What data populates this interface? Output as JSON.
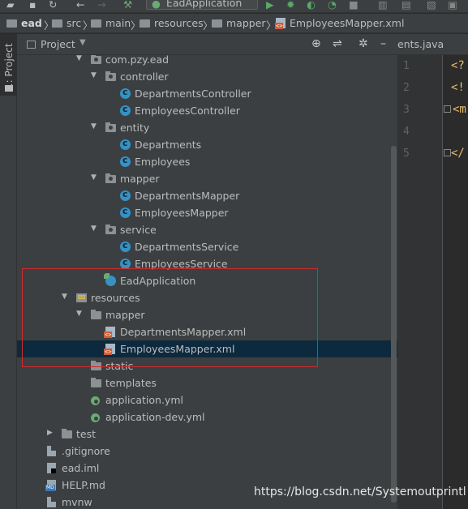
{
  "toolbar": {
    "run_config": "EadApplication"
  },
  "breadcrumb": [
    {
      "label": "ead",
      "bold": true
    },
    {
      "label": "src"
    },
    {
      "label": "main"
    },
    {
      "label": "resources"
    },
    {
      "label": "mapper"
    },
    {
      "label": "EmployeesMapper.xml"
    }
  ],
  "sidebar": {
    "tab_label": "1: Project"
  },
  "project_panel": {
    "title": "Project"
  },
  "tree": [
    {
      "label": "com.pzy.ead",
      "icon": "package-folder-icon",
      "indent": 1,
      "expanded": true
    },
    {
      "label": "controller",
      "icon": "package-folder-icon",
      "indent": 2,
      "expanded": true
    },
    {
      "label": "DepartmentsController",
      "icon": "class-icon",
      "indent": 3
    },
    {
      "label": "EmployeesController",
      "icon": "class-icon",
      "indent": 3
    },
    {
      "label": "entity",
      "icon": "package-folder-icon",
      "indent": 2,
      "expanded": true
    },
    {
      "label": "Departments",
      "icon": "class-icon",
      "indent": 3
    },
    {
      "label": "Employees",
      "icon": "class-icon",
      "indent": 3
    },
    {
      "label": "mapper",
      "icon": "package-folder-icon",
      "indent": 2,
      "expanded": true
    },
    {
      "label": "DepartmentsMapper",
      "icon": "class-icon",
      "indent": 3
    },
    {
      "label": "EmployeesMapper",
      "icon": "class-icon",
      "indent": 3
    },
    {
      "label": "service",
      "icon": "package-folder-icon",
      "indent": 2,
      "expanded": true
    },
    {
      "label": "DepartmentsService",
      "icon": "class-icon",
      "indent": 3
    },
    {
      "label": "EmployeesService",
      "icon": "class-icon",
      "indent": 3
    },
    {
      "label": "EadApplication",
      "icon": "spring-boot-class-icon",
      "indent": 2
    },
    {
      "label": "resources",
      "icon": "resources-folder-icon",
      "indent": 0,
      "expanded": true
    },
    {
      "label": "mapper",
      "icon": "folder-icon",
      "indent": 1,
      "expanded": true
    },
    {
      "label": "DepartmentsMapper.xml",
      "icon": "xml-file-icon",
      "indent": 2
    },
    {
      "label": "EmployeesMapper.xml",
      "icon": "xml-file-icon",
      "indent": 2,
      "selected": true
    },
    {
      "label": "static",
      "icon": "folder-icon",
      "indent": 1
    },
    {
      "label": "templates",
      "icon": "folder-icon",
      "indent": 1
    },
    {
      "label": "application.yml",
      "icon": "yml-config-icon",
      "indent": 1
    },
    {
      "label": "application-dev.yml",
      "icon": "yml-config-icon",
      "indent": 1
    },
    {
      "label": "test",
      "icon": "folder-icon",
      "indent": -1,
      "collapsed": true
    },
    {
      "label": ".gitignore",
      "icon": "gitignore-file-icon",
      "indent": -2
    },
    {
      "label": "ead.iml",
      "icon": "iml-file-icon",
      "indent": -2
    },
    {
      "label": "HELP.md",
      "icon": "markdown-file-icon",
      "indent": -2
    },
    {
      "label": "mvnw",
      "icon": "file-icon",
      "indent": -2
    }
  ],
  "editor": {
    "tab_label": "ents.java",
    "line_numbers": [
      "1",
      "2",
      "3",
      "4",
      "5"
    ],
    "lines": [
      "<?",
      "<!",
      "<m",
      "",
      "</"
    ]
  },
  "colors": {
    "selection": "#0d293e",
    "highlight_border": "#d12b2b",
    "xml_tag": "#e8bf6a"
  },
  "watermark": "https://blog.csdn.net/Systemoutprintl"
}
